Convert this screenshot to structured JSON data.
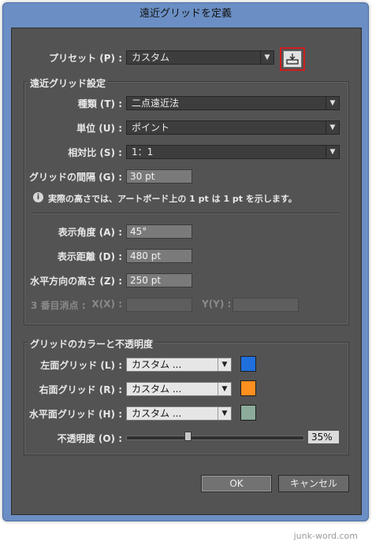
{
  "window": {
    "title": "遠近グリッドを定義"
  },
  "preset": {
    "label": "プリセット (P) :",
    "value": "カスタム"
  },
  "perspective_group": {
    "title": "遠近グリッド設定",
    "type": {
      "label": "種類 (T) :",
      "value": "二点遠近法"
    },
    "unit": {
      "label": "単位 (U) :",
      "value": "ポイント"
    },
    "ratio": {
      "label": "相対比 (S) :",
      "value": "1：1"
    },
    "grid_spacing": {
      "label": "グリッドの間隔 (G) :",
      "value": "30 pt"
    },
    "info": "実際の高さでは、アートボード上の 1 pt は 1 pt を示します。",
    "view_angle": {
      "label": "表示角度 (A) :",
      "value": "45°"
    },
    "view_distance": {
      "label": "表示距離 (D) :",
      "value": "480 pt"
    },
    "horizon_height": {
      "label": "水平方向の高さ (Z) :",
      "value": "250 pt"
    },
    "third_vp": {
      "label": "3 番目消点 :",
      "x_label": "X(X) :",
      "x_value": "",
      "y_label": "Y(Y) :",
      "y_value": ""
    }
  },
  "color_group": {
    "title": "グリッドのカラーと不透明度",
    "left_grid": {
      "label": "左面グリッド (L) :",
      "value": "カスタム ...",
      "color": "#1f6fdc"
    },
    "right_grid": {
      "label": "右面グリッド (R) :",
      "value": "カスタム ...",
      "color": "#ff8f1f"
    },
    "horizontal_grid": {
      "label": "水平面グリッド (H) :",
      "value": "カスタム ...",
      "color": "#8cab9b"
    },
    "opacity": {
      "label": "不透明度 (O) :",
      "value": "35%",
      "level": 0.35
    }
  },
  "buttons": {
    "ok": "OK",
    "cancel": "キャンセル"
  },
  "watermark": "junk-word.com"
}
